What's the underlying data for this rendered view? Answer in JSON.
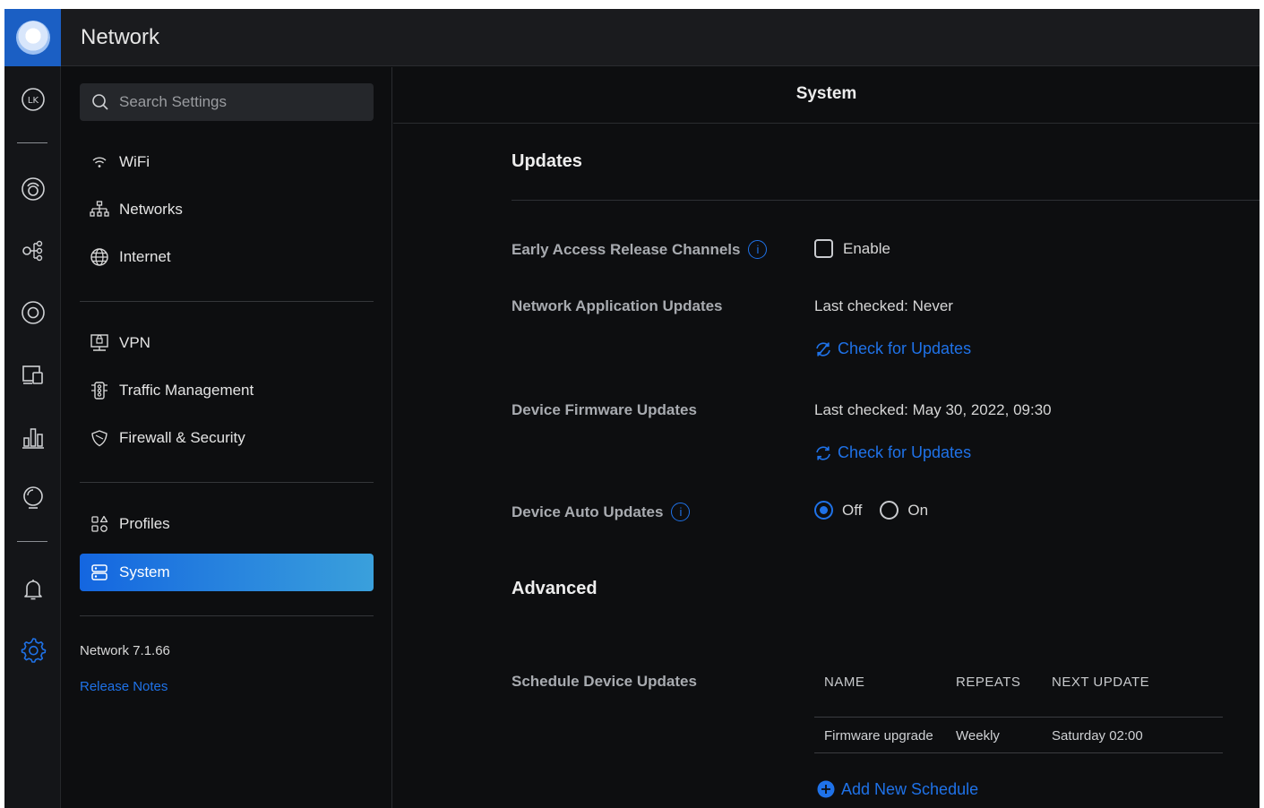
{
  "header": {
    "title": "Network"
  },
  "rail": {
    "items": [
      {
        "icon": "user-avatar-icon",
        "text": "LK"
      },
      {
        "icon": "dashboard-icon"
      },
      {
        "icon": "topology-icon"
      },
      {
        "icon": "devices-icon"
      },
      {
        "icon": "clients-icon"
      },
      {
        "icon": "statistics-icon"
      },
      {
        "icon": "insights-icon"
      },
      {
        "icon": "notifications-icon"
      },
      {
        "icon": "settings-icon"
      }
    ],
    "accent": "#1f72e8"
  },
  "nav": {
    "search_placeholder": "Search Settings",
    "items": [
      {
        "label": "WiFi",
        "icon": "wifi-icon"
      },
      {
        "label": "Networks",
        "icon": "networks-icon"
      },
      {
        "label": "Internet",
        "icon": "globe-icon"
      },
      {
        "label": "VPN",
        "icon": "vpn-icon"
      },
      {
        "label": "Traffic Management",
        "icon": "traffic-icon"
      },
      {
        "label": "Firewall & Security",
        "icon": "shield-icon"
      },
      {
        "label": "Profiles",
        "icon": "profiles-icon"
      },
      {
        "label": "System",
        "icon": "system-icon",
        "active": true
      }
    ],
    "version": "Network 7.1.66",
    "release_notes": "Release Notes"
  },
  "main": {
    "title": "System",
    "updates_heading": "Updates",
    "early_access": {
      "label": "Early Access Release Channels",
      "checkbox_label": "Enable",
      "checked": false
    },
    "app_updates": {
      "label": "Network Application Updates",
      "status": "Last checked: Never",
      "action": "Check for Updates"
    },
    "firmware_updates": {
      "label": "Device Firmware Updates",
      "status": "Last checked: May 30, 2022, 09:30",
      "action": "Check for Updates"
    },
    "auto_updates": {
      "label": "Device Auto Updates",
      "options": [
        "Off",
        "On"
      ],
      "selected": "Off"
    },
    "advanced_heading": "Advanced",
    "schedule": {
      "label": "Schedule Device Updates",
      "columns": [
        "NAME",
        "REPEATS",
        "NEXT UPDATE"
      ],
      "rows": [
        {
          "name": "Firmware upgrade",
          "repeats": "Weekly",
          "next_update": "Saturday 02:00"
        }
      ],
      "add_label": "Add New Schedule"
    }
  }
}
